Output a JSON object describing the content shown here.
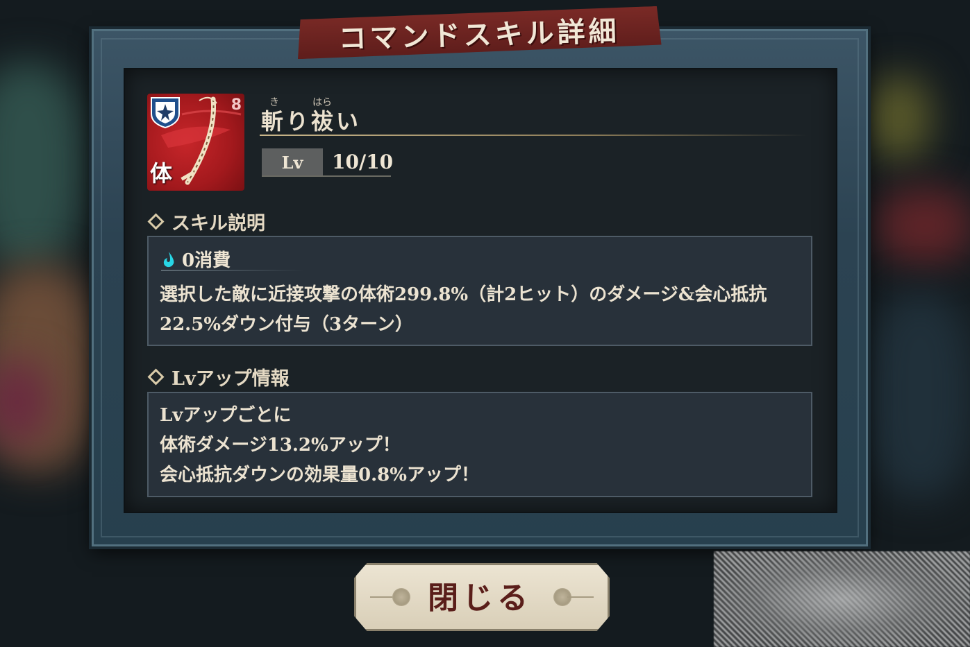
{
  "dialog": {
    "title": "コマンドスキル詳細"
  },
  "skill": {
    "ruby_1": "き",
    "ruby_2": "はら",
    "name": "斬り祓い",
    "level_label": "Lv",
    "level_value": "10/10",
    "cost_badge": "8",
    "type_badge": "体",
    "icon": "katana-icon",
    "badge_icon": "shield-shuriken-icon",
    "accent_color": "#b81e22"
  },
  "description": {
    "header": "スキル説明",
    "cost_text": "0消費",
    "cost_icon": "cyan-flame-drop-icon",
    "lines": [
      "選択した敵に近接攻撃の体術299.8%（計2ヒット）のダメージ&会心抵抗",
      "22.5%ダウン付与（3ターン）"
    ]
  },
  "level_up": {
    "header": "Lvアップ情報",
    "lines": [
      "Lvアップごとに",
      "体術ダメージ13.2%アップ！",
      "会心抵抗ダウンの効果量0.8%アップ！"
    ]
  },
  "buttons": {
    "close_label": "閉じる"
  }
}
